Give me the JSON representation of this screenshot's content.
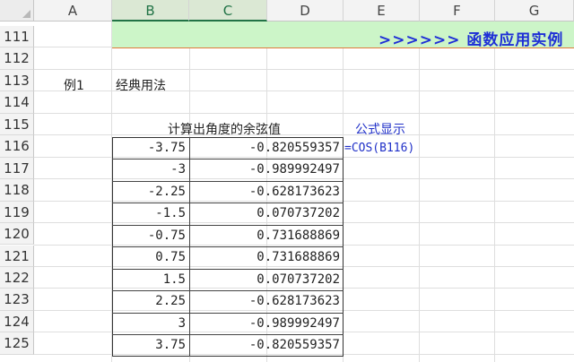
{
  "columns": [
    "A",
    "B",
    "C",
    "D",
    "E",
    "F",
    "G"
  ],
  "rows": [
    "111",
    "112",
    "113",
    "114",
    "115",
    "116",
    "117",
    "118",
    "119",
    "120",
    "121",
    "122",
    "123",
    "124",
    "125"
  ],
  "banner": ">>>>>>   函数应用实例",
  "example_label": "例1",
  "example_title": "经典用法",
  "table_header": "计算出角度的余弦值",
  "formula_header": "公式显示",
  "formula_text": "=COS(B116)",
  "table": [
    {
      "b": "-3.75",
      "c": "-0.820559357"
    },
    {
      "b": "-3",
      "c": "-0.989992497"
    },
    {
      "b": "-2.25",
      "c": "-0.628173623"
    },
    {
      "b": "-1.5",
      "c": "0.070737202"
    },
    {
      "b": "-0.75",
      "c": "0.731688869"
    },
    {
      "b": "0.75",
      "c": "0.731688869"
    },
    {
      "b": "1.5",
      "c": "0.070737202"
    },
    {
      "b": "2.25",
      "c": "-0.628173623"
    },
    {
      "b": "3",
      "c": "-0.989992497"
    },
    {
      "b": "3.75",
      "c": "-0.820559357"
    }
  ]
}
